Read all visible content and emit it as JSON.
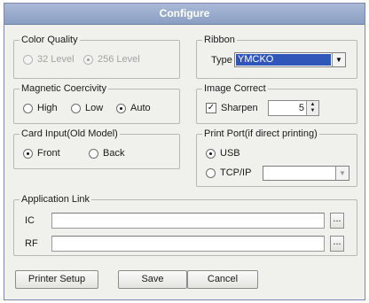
{
  "window": {
    "title": "Configure"
  },
  "color_quality": {
    "legend": "Color Quality",
    "options": [
      {
        "label": "32 Level",
        "checked": false,
        "disabled": true
      },
      {
        "label": "256 Level",
        "checked": true,
        "disabled": true
      }
    ]
  },
  "ribbon": {
    "legend": "Ribbon",
    "type_label": "Type",
    "type_value": "YMCKO"
  },
  "magnetic": {
    "legend": "Magnetic Coercivity",
    "options": [
      {
        "label": "High",
        "checked": false
      },
      {
        "label": "Low",
        "checked": false
      },
      {
        "label": "Auto",
        "checked": true
      }
    ]
  },
  "image_correct": {
    "legend": "Image Correct",
    "sharpen_label": "Sharpen",
    "sharpen_checked": true,
    "sharpen_value": "5"
  },
  "card_input": {
    "legend": "Card Input(Old Model)",
    "options": [
      {
        "label": "Front",
        "checked": true
      },
      {
        "label": "Back",
        "checked": false
      }
    ]
  },
  "print_port": {
    "legend": "Print Port(if direct printing)",
    "options": [
      {
        "label": "USB",
        "checked": true
      },
      {
        "label": "TCP/IP",
        "checked": false
      }
    ],
    "tcp_value": ""
  },
  "application_link": {
    "legend": "Application Link",
    "ic_label": "IC",
    "ic_value": "",
    "rf_label": "RF",
    "rf_value": "",
    "browse_label": "..."
  },
  "buttons": {
    "printer_setup": "Printer Setup",
    "save": "Save",
    "cancel": "Cancel"
  }
}
